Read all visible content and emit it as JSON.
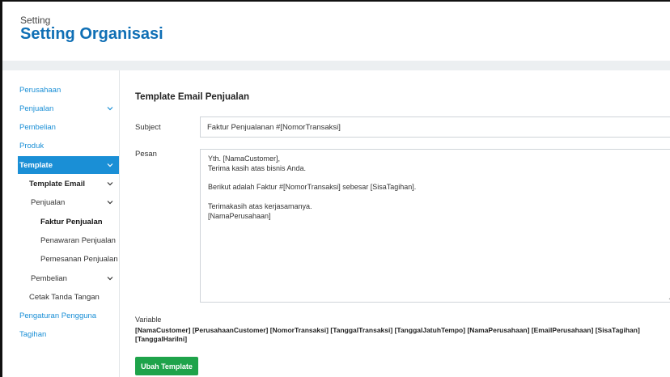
{
  "header": {
    "breadcrumb": "Setting",
    "title": "Setting Organisasi"
  },
  "sidebar": {
    "items": [
      {
        "label": "Perusahaan"
      },
      {
        "label": "Penjualan"
      },
      {
        "label": "Pembelian"
      },
      {
        "label": "Produk"
      },
      {
        "label": "Template"
      },
      {
        "label": "Template Email"
      },
      {
        "label": "Penjualan"
      },
      {
        "label": "Faktur Penjualan"
      },
      {
        "label": "Penawaran Penjualan"
      },
      {
        "label": "Pemesanan Penjualan"
      },
      {
        "label": "Pembelian"
      },
      {
        "label": "Cetak Tanda Tangan"
      },
      {
        "label": "Pengaturan Pengguna"
      },
      {
        "label": "Tagihan"
      }
    ]
  },
  "main": {
    "section_title": "Template Email Penjualan",
    "subject_label": "Subject",
    "subject_value": "Faktur Penjualanan #[NomorTransaksi]",
    "message_label": "Pesan",
    "message_lines": [
      "Yth. [NamaCustomer],",
      "Terima kasih atas bisnis Anda.",
      "",
      "Berikut adalah Faktur #[NomorTransaksi] sebesar [SisaTagihan].",
      "",
      "Terimakasih atas kerjasamanya.",
      "[NamaPerusahaan]"
    ],
    "variable_label": "Variable",
    "variables": "[NamaCustomer] [PerusahaanCustomer] [NomorTransaksi] [TanggalTransaksi] [TanggalJatuhTempo] [NamaPerusahaan] [EmailPerusahaan] [SisaTagihan] [TanggalHariIni]",
    "submit_label": "Ubah Template"
  },
  "colors": {
    "accent": "#1a8fd6",
    "title": "#0f6fb5",
    "button": "#1ea34a"
  }
}
